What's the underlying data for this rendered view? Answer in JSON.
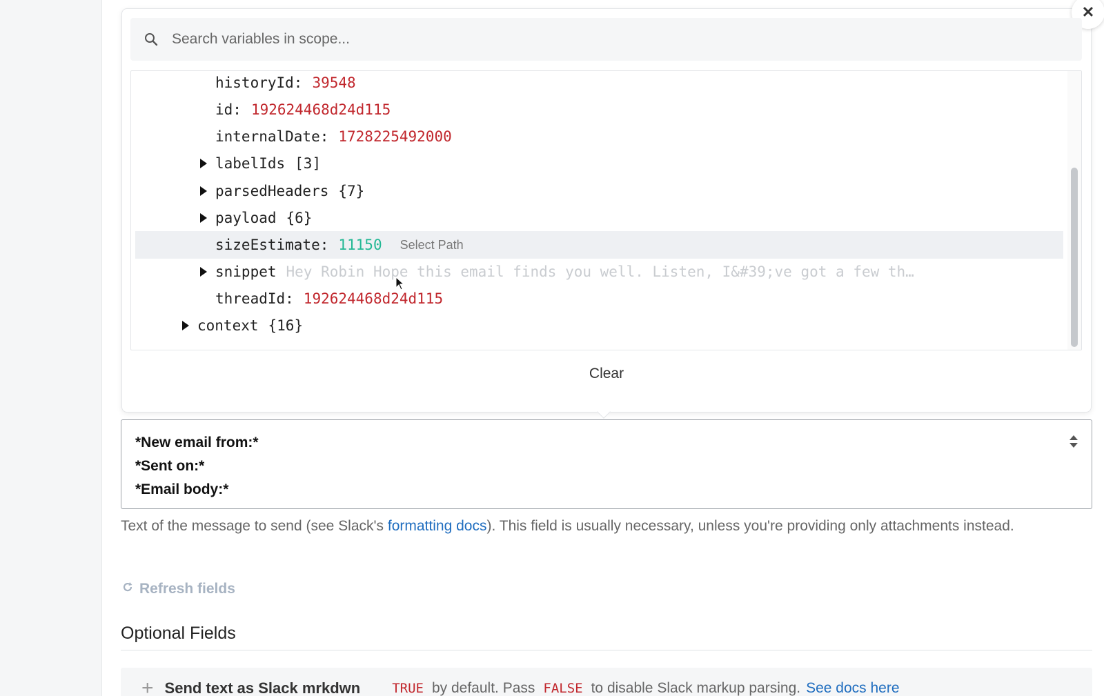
{
  "search": {
    "placeholder": "Search variables in scope..."
  },
  "tree": {
    "rows": [
      {
        "key": "historyId:",
        "value": "39548"
      },
      {
        "key": "id:",
        "value": "192624468d24d115"
      },
      {
        "key": "internalDate:",
        "value": "1728225492000"
      },
      {
        "key": "labelIds",
        "meta": "[3]"
      },
      {
        "key": "parsedHeaders",
        "meta": "{7}"
      },
      {
        "key": "payload",
        "meta": "{6}"
      },
      {
        "key": "sizeEstimate:",
        "value": "11150",
        "action": "Select Path"
      },
      {
        "key": "snippet",
        "preview": "Hey Robin Hope this email finds you well. Listen, I&#39;ve got a few th…"
      },
      {
        "key": "threadId:",
        "value": "192624468d24d115"
      },
      {
        "key": "context",
        "meta": "{16}"
      }
    ]
  },
  "popup": {
    "clear_label": "Clear",
    "close_glyph": "✕"
  },
  "message": {
    "lines": [
      "*New email from:*",
      "*Sent on:*",
      "*Email body:*"
    ],
    "help_before": "Text of the message to send (see Slack's ",
    "help_link": "formatting docs",
    "help_after": "). This field is usually necessary, unless you're providing only attachments instead."
  },
  "refresh_label": "Refresh fields",
  "optional": {
    "title": "Optional Fields",
    "field_name": "Send text as Slack mrkdwn",
    "kw_true": "TRUE",
    "desc_mid": "by default. Pass",
    "kw_false": "FALSE",
    "desc_end": "to disable Slack markup parsing.",
    "docs_link": "See docs here"
  },
  "colors": {
    "string_value": "#c1272d",
    "number_value": "#22b894",
    "link": "#1f6dbf"
  }
}
